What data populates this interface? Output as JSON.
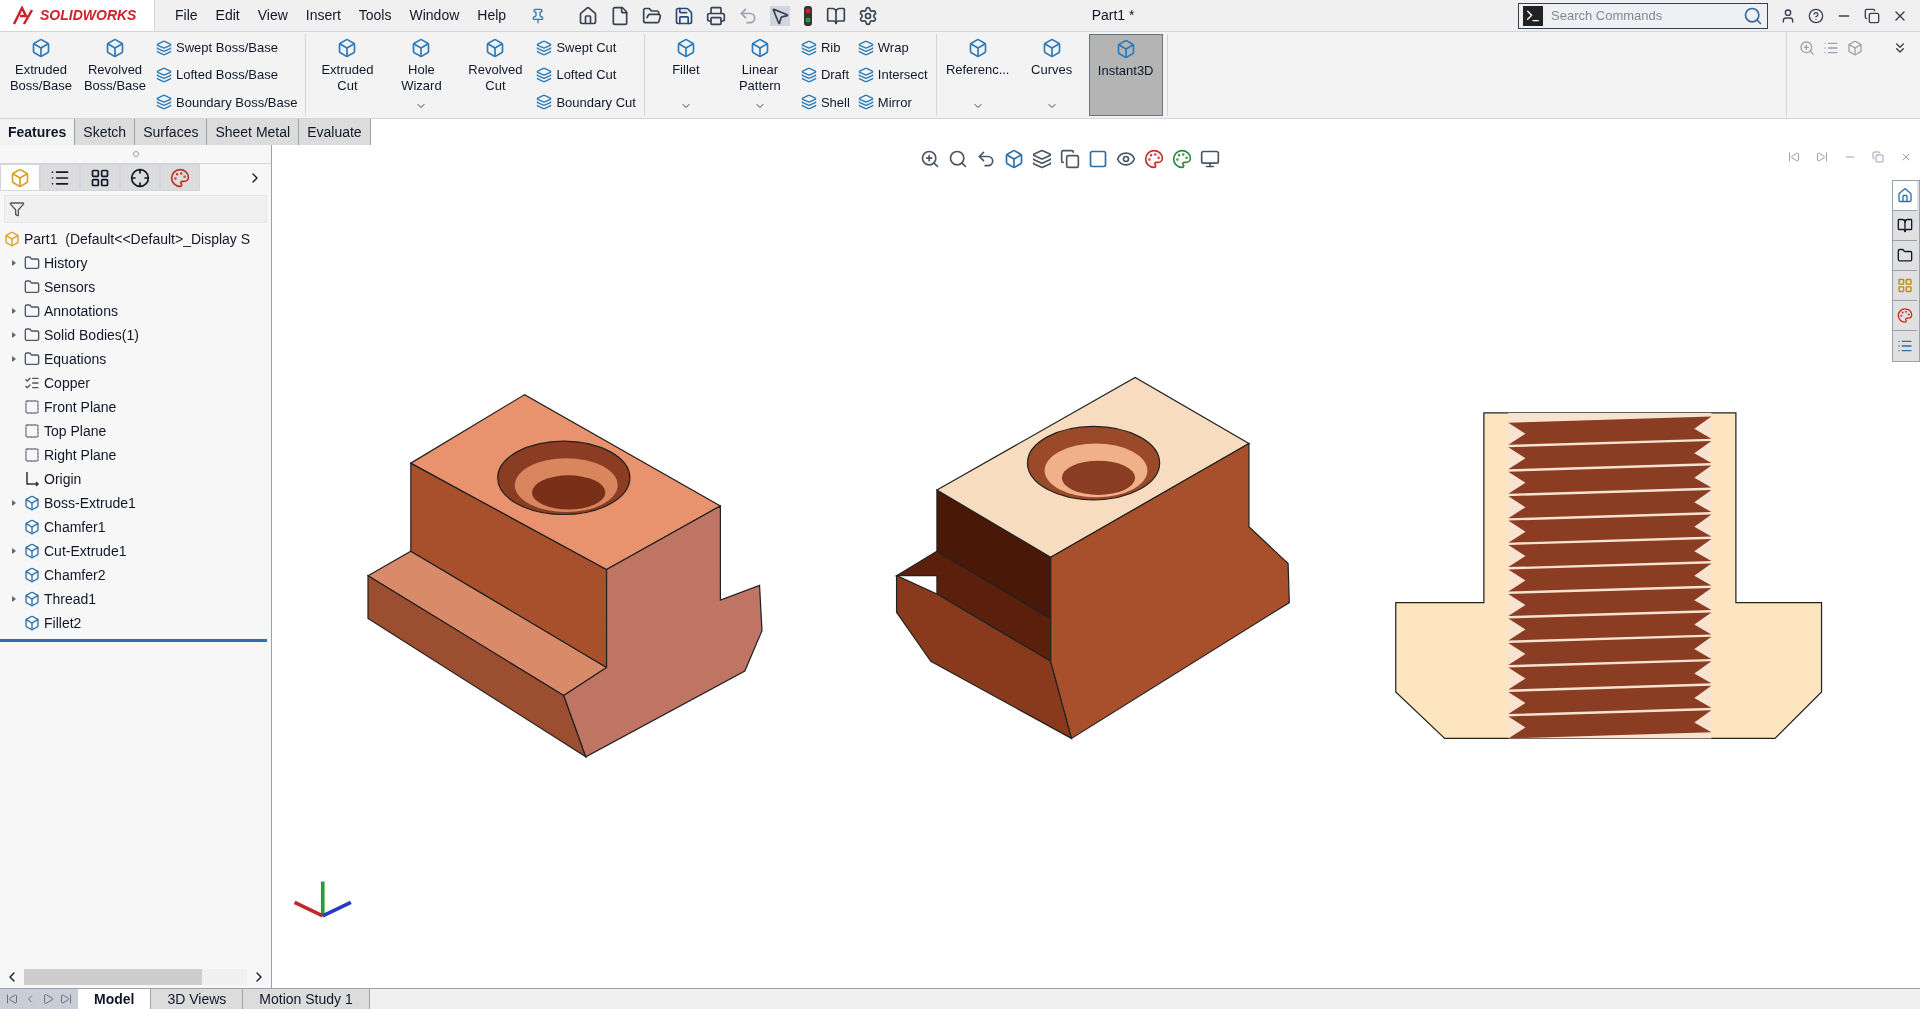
{
  "app": {
    "logo": "SOLIDWORKS"
  },
  "menu": [
    "File",
    "Edit",
    "View",
    "Insert",
    "Tools",
    "Window",
    "Help"
  ],
  "document_title": "Part1 *",
  "search": {
    "placeholder": "Search Commands"
  },
  "command_groups": [
    {
      "items": [
        {
          "kind": "large",
          "label": "Extruded Boss/Base",
          "dropdown": false,
          "selected": false
        },
        {
          "kind": "large",
          "label": "Revolved Boss/Base",
          "dropdown": false,
          "selected": false
        },
        {
          "kind": "stack",
          "labels": [
            "Swept Boss/Base",
            "Lofted Boss/Base",
            "Boundary Boss/Base"
          ]
        }
      ]
    },
    {
      "items": [
        {
          "kind": "large",
          "label": "Extruded Cut",
          "dropdown": false,
          "selected": false
        },
        {
          "kind": "large",
          "label": "Hole Wizard",
          "dropdown": true,
          "selected": false
        },
        {
          "kind": "large",
          "label": "Revolved Cut",
          "dropdown": false,
          "selected": false
        },
        {
          "kind": "stack",
          "labels": [
            "Swept Cut",
            "Lofted Cut",
            "Boundary Cut"
          ]
        }
      ]
    },
    {
      "items": [
        {
          "kind": "large",
          "label": "Fillet",
          "dropdown": true,
          "selected": false
        },
        {
          "kind": "large",
          "label": "Linear Pattern",
          "dropdown": true,
          "selected": false
        },
        {
          "kind": "stack",
          "labels": [
            "Rib",
            "Draft",
            "Shell"
          ]
        },
        {
          "kind": "stack",
          "labels": [
            "Wrap",
            "Intersect",
            "Mirror"
          ]
        }
      ]
    },
    {
      "items": [
        {
          "kind": "large",
          "label": "Referenc...",
          "dropdown": true,
          "selected": false
        },
        {
          "kind": "large",
          "label": "Curves",
          "dropdown": true,
          "selected": false
        },
        {
          "kind": "large",
          "label": "Instant3D",
          "dropdown": false,
          "selected": true
        }
      ]
    }
  ],
  "tabs": [
    {
      "label": "Features",
      "selected": true
    },
    {
      "label": "Sketch",
      "selected": false
    },
    {
      "label": "Surfaces",
      "selected": false
    },
    {
      "label": "Sheet Metal",
      "selected": false
    },
    {
      "label": "Evaluate",
      "selected": false
    }
  ],
  "tree": {
    "root": "Part1  (Default<<Default>_Display S",
    "items": [
      {
        "label": "History",
        "kind": "folder",
        "expandable": true
      },
      {
        "label": "Sensors",
        "kind": "folder",
        "expandable": false
      },
      {
        "label": "Annotations",
        "kind": "folder",
        "expandable": true
      },
      {
        "label": "Solid Bodies(1)",
        "kind": "folder",
        "expandable": true
      },
      {
        "label": "Equations",
        "kind": "folder",
        "expandable": true
      },
      {
        "label": "Copper",
        "kind": "material",
        "expandable": false
      },
      {
        "label": "Front Plane",
        "kind": "plane",
        "expandable": false
      },
      {
        "label": "Top Plane",
        "kind": "plane",
        "expandable": false
      },
      {
        "label": "Right Plane",
        "kind": "plane",
        "expandable": false
      },
      {
        "label": "Origin",
        "kind": "origin",
        "expandable": false
      },
      {
        "label": "Boss-Extrude1",
        "kind": "feature",
        "expandable": true
      },
      {
        "label": "Chamfer1",
        "kind": "feature",
        "expandable": false
      },
      {
        "label": "Cut-Extrude1",
        "kind": "feature",
        "expandable": true
      },
      {
        "label": "Chamfer2",
        "kind": "feature",
        "expandable": false
      },
      {
        "label": "Thread1",
        "kind": "feature",
        "expandable": true
      },
      {
        "label": "Fillet2",
        "kind": "feature",
        "expandable": false
      }
    ]
  },
  "bottom_tabs": [
    {
      "label": "Model",
      "selected": true
    },
    {
      "label": "3D Views",
      "selected": false
    },
    {
      "label": "Motion Study 1",
      "selected": false
    }
  ]
}
